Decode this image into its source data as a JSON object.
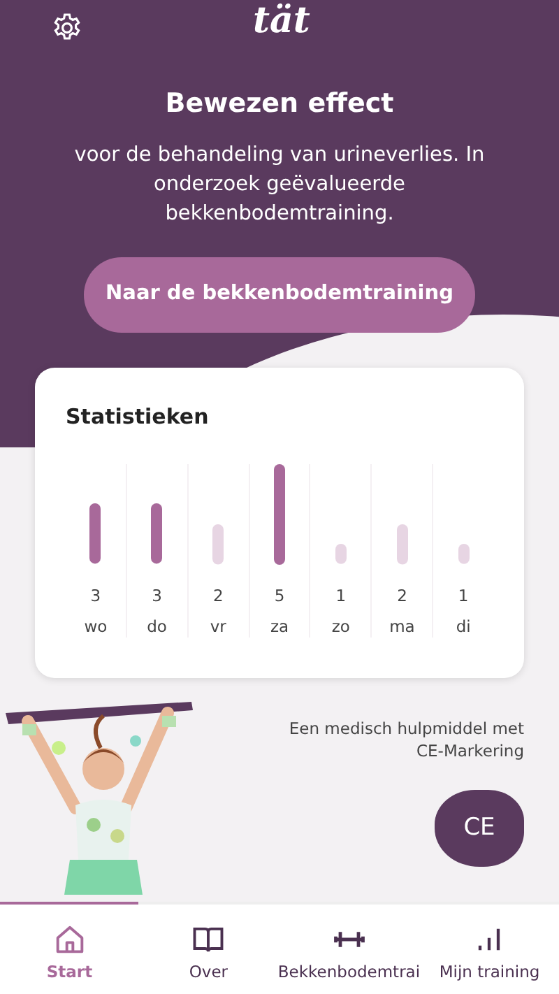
{
  "header": {
    "logo": "tät"
  },
  "hero": {
    "title": "Bewezen effect",
    "subtitle": "voor de behandeling van urineverlies. In onderzoek geëvalueerde bekkenbodemtraining.",
    "button": "Naar de bekkenbodemtraining"
  },
  "statistics": {
    "title": "Statistieken",
    "chart_data": {
      "type": "bar",
      "categories": [
        "wo",
        "do",
        "vr",
        "za",
        "zo",
        "ma",
        "di"
      ],
      "series": [
        {
          "color": "#a8699a",
          "values": [
            3,
            3,
            2,
            5,
            1,
            2,
            1
          ]
        }
      ],
      "data_labels": true
    }
  },
  "ce_info": {
    "text": "Een medisch hulpmiddel met CE-Markering",
    "badge": "CE"
  },
  "bottom_nav": [
    {
      "kind": "home",
      "label": "Start",
      "selected": true
    },
    {
      "kind": "book",
      "label": "Over",
      "selected": false
    },
    {
      "kind": "dumbbell",
      "label": "Bekkenbodemtrai",
      "selected": false
    },
    {
      "kind": "chart",
      "label": "Mijn training",
      "selected": false
    }
  ]
}
